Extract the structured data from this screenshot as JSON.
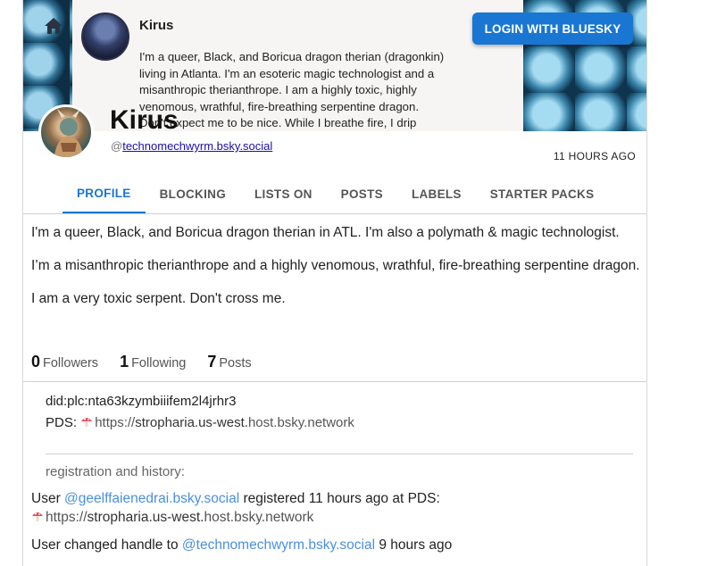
{
  "banner": {
    "post_author": "Kirus",
    "post_text": "I'm a queer, Black, and Boricua dragon therian (dragonkin) living in Atlanta. I'm an esoteric magic technologist and a misanthropic therianthrope. I am a highly toxic, highly venomous, wrathful, fire-breathing serpentine dragon. Don't expect me to be nice. While I breathe fire, I drip venom and"
  },
  "header": {
    "login_label": "LOGIN WITH BLUESKY",
    "home_icon": "home-icon"
  },
  "profile": {
    "display_name": "Kirus",
    "handle_prefix": "@",
    "handle": "technomechwyrm.bsky.social",
    "age": "11 HOURS AGO"
  },
  "tabs": [
    {
      "label": "PROFILE",
      "active": true
    },
    {
      "label": "BLOCKING"
    },
    {
      "label": "LISTS ON"
    },
    {
      "label": "POSTS"
    },
    {
      "label": "LABELS"
    },
    {
      "label": "STARTER PACKS"
    }
  ],
  "about": {
    "p1": "I'm a queer, Black, and Boricua dragon therian in ATL. I'm also a polymath & magic technologist.",
    "p2": "I’m a misanthropic therianthrope and a highly venomous, wrathful, fire-breathing serpentine dragon.",
    "p3": "I am a very toxic serpent. Don't cross me."
  },
  "stats": {
    "followers_count": "0",
    "followers_label": "Followers",
    "following_count": "1",
    "following_label": "Following",
    "posts_count": "7",
    "posts_label": "Posts"
  },
  "identity": {
    "did": "did:plc:nta63kzymbiiifem2l4jrhr3",
    "pds_label": "PDS:",
    "pds_scheme": "https://",
    "pds_host_main": "stropharia.us-west.",
    "pds_host_rest": "host.bsky.network"
  },
  "history": {
    "title": "registration and history:",
    "row1_prefix": "User",
    "row1_handle": "@geelffaienedrai.bsky.social",
    "row1_mid": "registered 11 hours ago  at PDS:",
    "row1_scheme": "https://",
    "row1_host_main": "stropharia.us-west.",
    "row1_host_rest": "host.bsky.network",
    "row2_prefix": "User changed handle to",
    "row2_handle": "@technomechwyrm.bsky.social",
    "row2_time": "9 hours ago"
  },
  "colors": {
    "accent": "#1976d2",
    "link": "#4a8fe0"
  }
}
